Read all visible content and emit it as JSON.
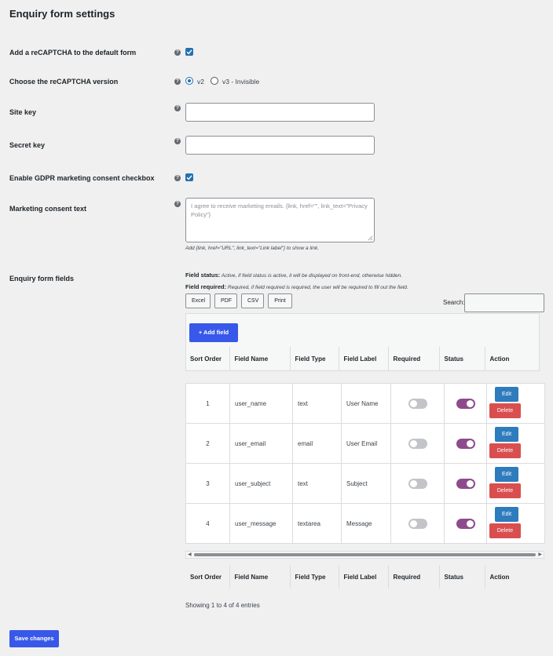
{
  "page_title": "Enquiry form settings",
  "settings": {
    "recaptcha_label": "Add a reCAPTCHA to the default form",
    "recaptcha_checked": true,
    "version_label": "Choose the reCAPTCHA version",
    "version_options": [
      "v2",
      "v3 - Invisible"
    ],
    "version_selected": "v2",
    "site_key_label": "Site key",
    "site_key_value": "",
    "secret_key_label": "Secret key",
    "secret_key_value": "",
    "gdpr_label": "Enable GDPR marketing consent checkbox",
    "gdpr_checked": true,
    "consent_text_label": "Marketing consent text",
    "consent_text_placeholder": "I agree to receive marketing emails. {link, href=\"\", link_text=\"Privacy Policy\"}",
    "consent_hint": "Add {link, href=\"URL\", link_text=\"Link label\"} to show a link.",
    "help_icon": "question-circle-icon"
  },
  "fields_section": {
    "label": "Enquiry form fields",
    "status_title": "Field status:",
    "status_text": "Active, if field status is active, it will be displayed on front-end, otherwise hidden.",
    "required_title": "Field required:",
    "required_text": "Required, if field required is required, the user will be required to fill out the field.",
    "export_buttons": [
      "Excel",
      "PDF",
      "CSV",
      "Print"
    ],
    "search_label": "Search:",
    "search_value": "",
    "add_field_label": "+ Add field",
    "columns": [
      "Sort Order",
      "Field Name",
      "Field Type",
      "Field Label",
      "Required",
      "Status",
      "Action"
    ],
    "rows": [
      {
        "order": "1",
        "name": "user_name",
        "type": "text",
        "label": "User Name",
        "required": false,
        "active": true
      },
      {
        "order": "2",
        "name": "user_email",
        "type": "email",
        "label": "User Email",
        "required": false,
        "active": true
      },
      {
        "order": "3",
        "name": "user_subject",
        "type": "text",
        "label": "Subject",
        "required": false,
        "active": true
      },
      {
        "order": "4",
        "name": "user_message",
        "type": "textarea",
        "label": "Message",
        "required": false,
        "active": true
      }
    ],
    "edit_label": "Edit",
    "delete_label": "Delete",
    "entries_info": "Showing 1 to 4 of 4 entries"
  },
  "save_label": "Save changes",
  "colors": {
    "primary": "#3858e9",
    "checkbox": "#2271b1",
    "toggle_on": "#8e4b8b",
    "toggle_off": "#c3c4c7",
    "edit": "#2e7bbd",
    "delete": "#d94f4f"
  }
}
